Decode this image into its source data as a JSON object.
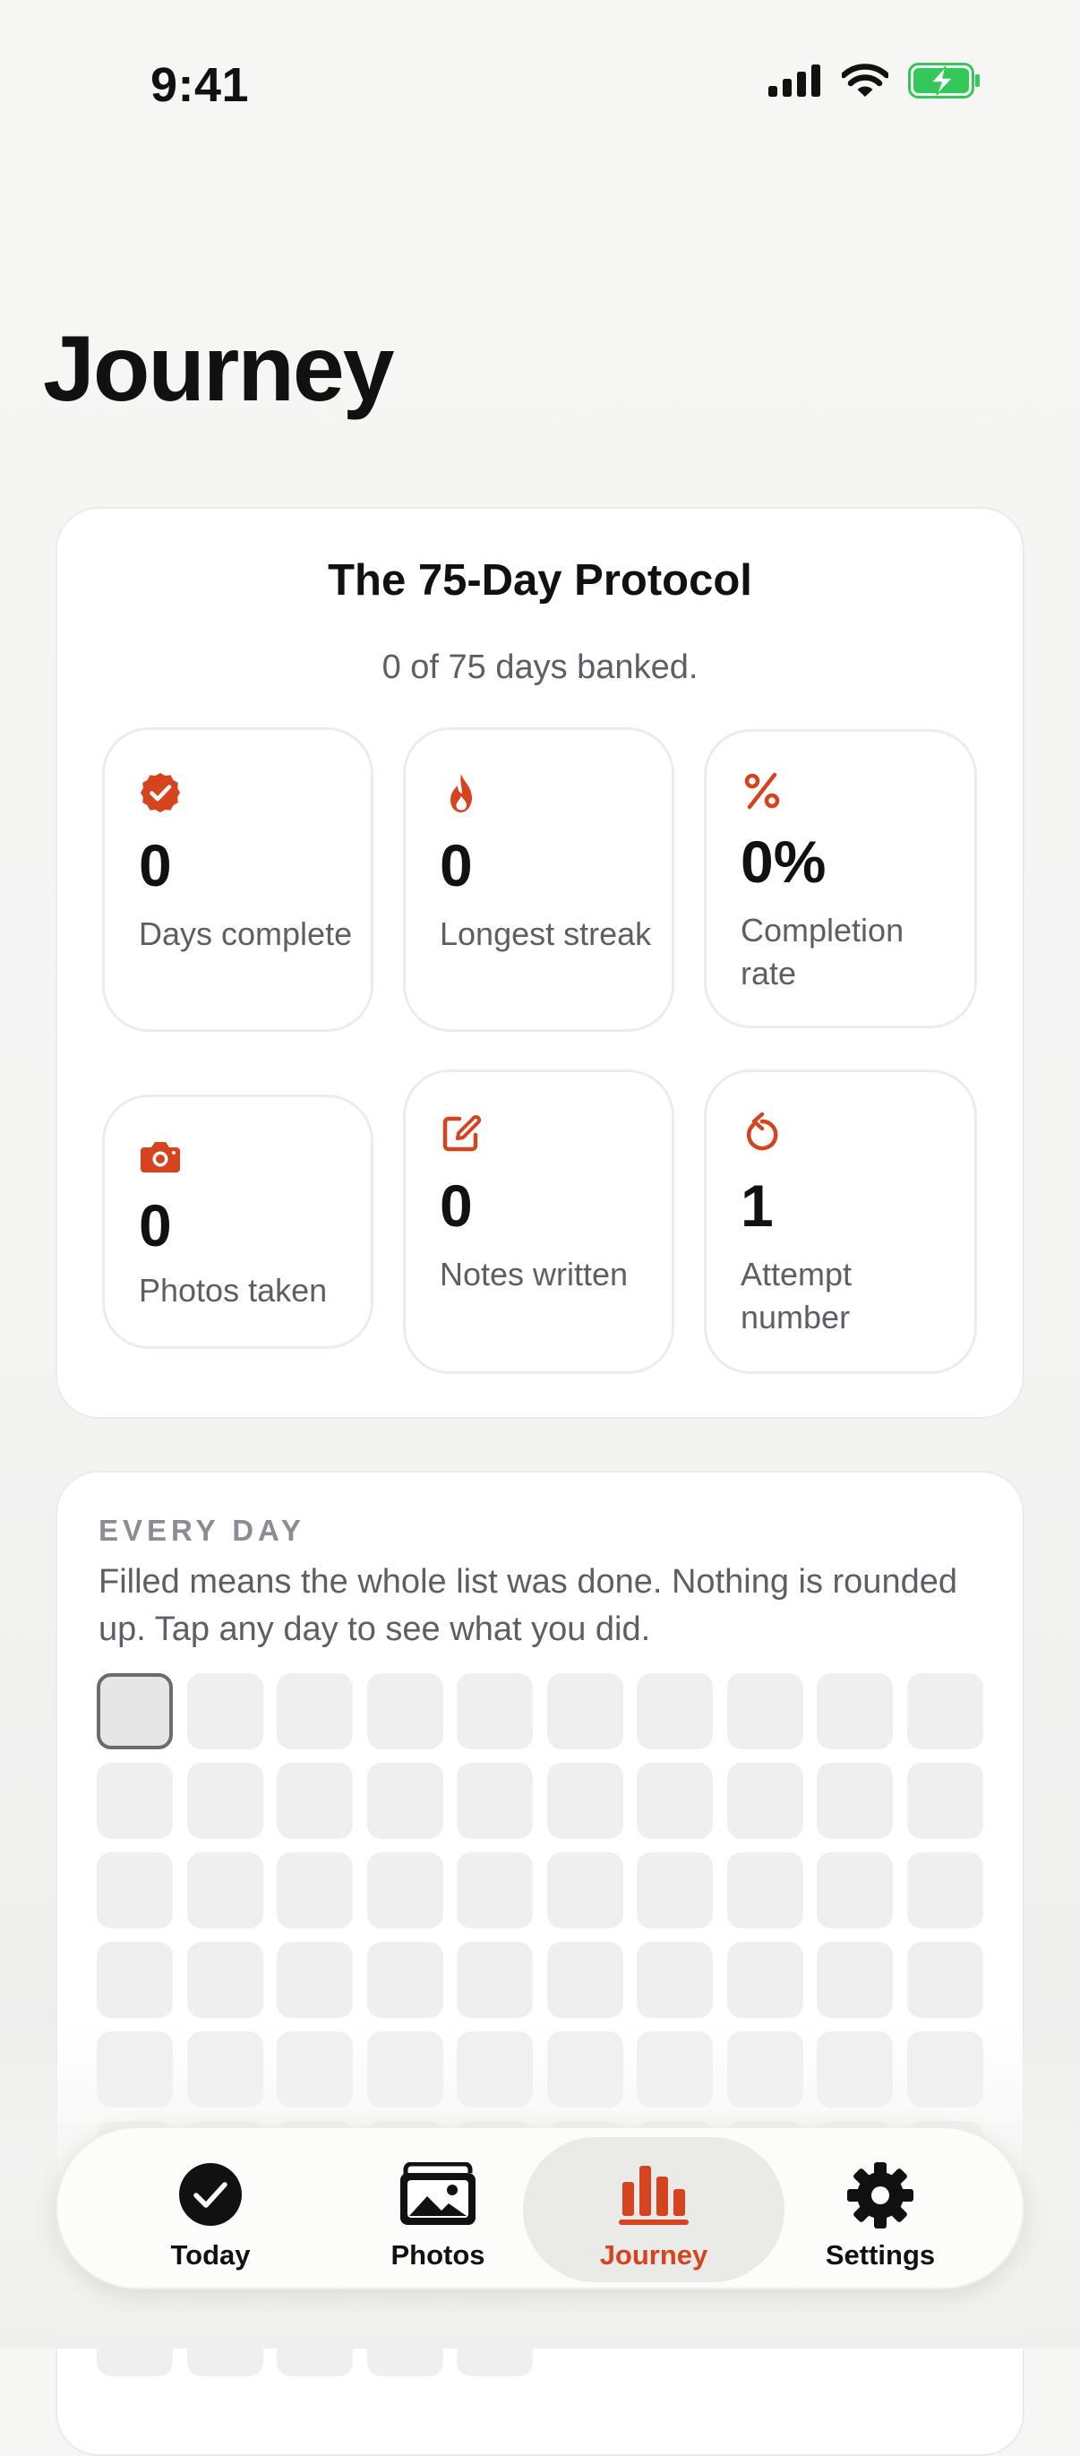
{
  "status_bar": {
    "time": "9:41",
    "battery_charging": true
  },
  "page": {
    "title": "Journey"
  },
  "protocol": {
    "title": "The 75-Day Protocol",
    "subtitle": "0 of 75 days banked.",
    "stats": [
      {
        "icon": "verified-badge-icon",
        "value": "0",
        "label": "Days complete"
      },
      {
        "icon": "flame-icon",
        "value": "0",
        "label": "Longest streak"
      },
      {
        "icon": "percent-icon",
        "value": "0%",
        "label": "Completion rate"
      },
      {
        "icon": "camera-icon",
        "value": "0",
        "label": "Photos taken"
      },
      {
        "icon": "edit-note-icon",
        "value": "0",
        "label": "Notes written"
      },
      {
        "icon": "retry-icon",
        "value": "1",
        "label": "Attempt number"
      }
    ]
  },
  "every_day": {
    "heading": "EVERY DAY",
    "description": "Filled means the whole list was done. Nothing is rounded up. Tap any day to see what you did.",
    "total_days": 75,
    "days_completed": 0,
    "current_day": 1
  },
  "tab_bar": {
    "tabs": [
      {
        "name": "today",
        "label": "Today",
        "icon": "checkmark-circle-icon",
        "active": false
      },
      {
        "name": "photos",
        "label": "Photos",
        "icon": "photos-icon",
        "active": false
      },
      {
        "name": "journey",
        "label": "Journey",
        "icon": "bar-chart-icon",
        "active": true
      },
      {
        "name": "settings",
        "label": "Settings",
        "icon": "gear-icon",
        "active": false
      }
    ]
  },
  "colors": {
    "accent": "#d6431f",
    "battery": "#34c759",
    "text_secondary": "#5c5f66",
    "heading_muted": "#8a8d93"
  }
}
